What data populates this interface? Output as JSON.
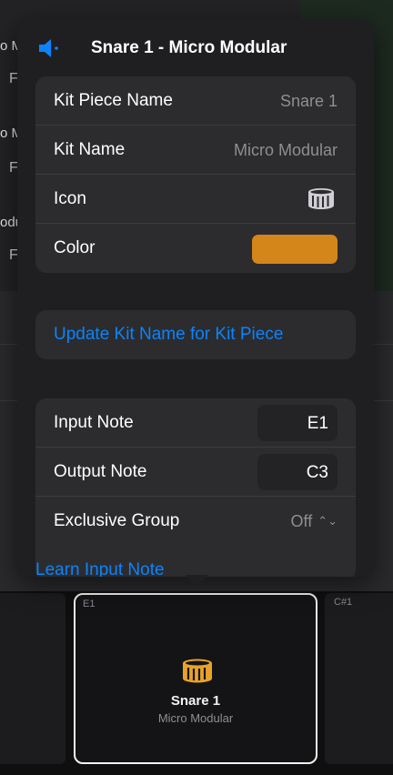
{
  "background": {
    "fragments": [
      {
        "text": "o M",
        "sub": "F"
      },
      {
        "text": "o M",
        "sub": "F"
      },
      {
        "text": "odu",
        "sub": "F"
      }
    ]
  },
  "popover": {
    "title": "Snare 1 - Micro Modular",
    "rows": {
      "kit_piece_name": {
        "label": "Kit Piece Name",
        "value": "Snare 1"
      },
      "kit_name": {
        "label": "Kit Name",
        "value": "Micro Modular"
      },
      "icon": {
        "label": "Icon"
      },
      "color": {
        "label": "Color",
        "swatch": "#D4861A"
      }
    },
    "update_button": "Update Kit Name for Kit Piece",
    "notes": {
      "input_note": {
        "label": "Input Note",
        "value": "E1"
      },
      "output_note": {
        "label": "Output Note",
        "value": "C3"
      },
      "exclusive_group": {
        "label": "Exclusive Group",
        "value": "Off"
      }
    },
    "learn_link": "Learn Input Note"
  },
  "pads": {
    "main": {
      "note": "E1",
      "name": "Snare 1",
      "kit": "Micro Modular"
    },
    "right": {
      "note": "C#1"
    }
  },
  "colors": {
    "accent": "#0A84FF",
    "pad_icon": "#E8A22A"
  }
}
